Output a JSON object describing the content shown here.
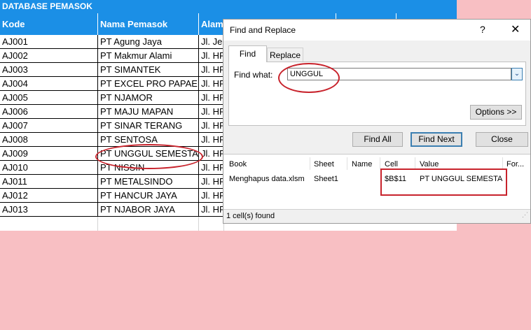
{
  "sheet": {
    "title": "DATABASE PEMASOK",
    "columns": [
      "Kode",
      "Nama Pemasok",
      "Alam"
    ],
    "rows": [
      {
        "kode": "AJ001",
        "nama": "PT Agung Jaya",
        "alamat": "Jl. Jer"
      },
      {
        "kode": "AJ002",
        "nama": "PT Makmur Alami",
        "alamat": "Jl. HR"
      },
      {
        "kode": "AJ003",
        "nama": "PT SIMANTEK",
        "alamat": "Jl. HR"
      },
      {
        "kode": "AJ004",
        "nama": "PT EXCEL PRO PAPAER",
        "alamat": "Jl. HR"
      },
      {
        "kode": "AJ005",
        "nama": "PT NJAMOR",
        "alamat": "Jl. HR"
      },
      {
        "kode": "AJ006",
        "nama": "PT MAJU MAPAN",
        "alamat": "Jl. HR"
      },
      {
        "kode": "AJ007",
        "nama": "PT SINAR TERANG",
        "alamat": "Jl. HR"
      },
      {
        "kode": "AJ008",
        "nama": "PT SENTOSA",
        "alamat": "Jl. HR"
      },
      {
        "kode": "AJ009",
        "nama": "PT UNGGUL SEMESTA",
        "alamat": "Jl. HR"
      },
      {
        "kode": "AJ010",
        "nama": "PT NISSIN",
        "alamat": "Jl. HR"
      },
      {
        "kode": "AJ011",
        "nama": "PT METALSINDO",
        "alamat": "Jl. HR"
      },
      {
        "kode": "AJ012",
        "nama": "PT HANCUR JAYA",
        "alamat": "Jl. HR"
      },
      {
        "kode": "AJ013",
        "nama": "PT NJABOR JAYA",
        "alamat": "Jl. HR"
      }
    ]
  },
  "dialog": {
    "title": "Find and Replace",
    "help": "?",
    "close": "✕",
    "tabs": {
      "find": "Find",
      "replace": "Replace"
    },
    "find_what_label": "Find what:",
    "find_what_value": "UNGGUL",
    "options_label": "Options >>",
    "buttons": {
      "find_all": "Find All",
      "find_next": "Find Next",
      "close": "Close"
    },
    "results": {
      "headers": {
        "book": "Book",
        "sheet": "Sheet",
        "name": "Name",
        "cell": "Cell",
        "value": "Value",
        "formula": "For..."
      },
      "row": {
        "book": "Menghapus data.xlsm",
        "sheet": "Sheet1",
        "name": "",
        "cell": "$B$11",
        "value": "PT UNGGUL SEMESTA"
      }
    },
    "status": "1 cell(s) found"
  },
  "colors": {
    "header_blue": "#1b8fe6",
    "background_pink": "#f8bfc3",
    "annotation_red": "#c8232c"
  }
}
